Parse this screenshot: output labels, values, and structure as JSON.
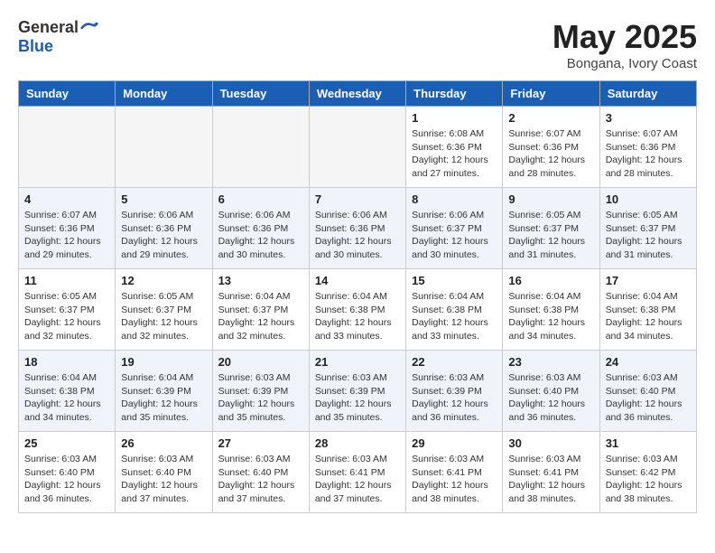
{
  "logo": {
    "general": "General",
    "blue": "Blue"
  },
  "title": "May 2025",
  "location": "Bongana, Ivory Coast",
  "days_of_week": [
    "Sunday",
    "Monday",
    "Tuesday",
    "Wednesday",
    "Thursday",
    "Friday",
    "Saturday"
  ],
  "weeks": [
    [
      {
        "num": "",
        "info": ""
      },
      {
        "num": "",
        "info": ""
      },
      {
        "num": "",
        "info": ""
      },
      {
        "num": "",
        "info": ""
      },
      {
        "num": "1",
        "info": "Sunrise: 6:08 AM\nSunset: 6:36 PM\nDaylight: 12 hours\nand 27 minutes."
      },
      {
        "num": "2",
        "info": "Sunrise: 6:07 AM\nSunset: 6:36 PM\nDaylight: 12 hours\nand 28 minutes."
      },
      {
        "num": "3",
        "info": "Sunrise: 6:07 AM\nSunset: 6:36 PM\nDaylight: 12 hours\nand 28 minutes."
      }
    ],
    [
      {
        "num": "4",
        "info": "Sunrise: 6:07 AM\nSunset: 6:36 PM\nDaylight: 12 hours\nand 29 minutes."
      },
      {
        "num": "5",
        "info": "Sunrise: 6:06 AM\nSunset: 6:36 PM\nDaylight: 12 hours\nand 29 minutes."
      },
      {
        "num": "6",
        "info": "Sunrise: 6:06 AM\nSunset: 6:36 PM\nDaylight: 12 hours\nand 30 minutes."
      },
      {
        "num": "7",
        "info": "Sunrise: 6:06 AM\nSunset: 6:36 PM\nDaylight: 12 hours\nand 30 minutes."
      },
      {
        "num": "8",
        "info": "Sunrise: 6:06 AM\nSunset: 6:37 PM\nDaylight: 12 hours\nand 30 minutes."
      },
      {
        "num": "9",
        "info": "Sunrise: 6:05 AM\nSunset: 6:37 PM\nDaylight: 12 hours\nand 31 minutes."
      },
      {
        "num": "10",
        "info": "Sunrise: 6:05 AM\nSunset: 6:37 PM\nDaylight: 12 hours\nand 31 minutes."
      }
    ],
    [
      {
        "num": "11",
        "info": "Sunrise: 6:05 AM\nSunset: 6:37 PM\nDaylight: 12 hours\nand 32 minutes."
      },
      {
        "num": "12",
        "info": "Sunrise: 6:05 AM\nSunset: 6:37 PM\nDaylight: 12 hours\nand 32 minutes."
      },
      {
        "num": "13",
        "info": "Sunrise: 6:04 AM\nSunset: 6:37 PM\nDaylight: 12 hours\nand 32 minutes."
      },
      {
        "num": "14",
        "info": "Sunrise: 6:04 AM\nSunset: 6:38 PM\nDaylight: 12 hours\nand 33 minutes."
      },
      {
        "num": "15",
        "info": "Sunrise: 6:04 AM\nSunset: 6:38 PM\nDaylight: 12 hours\nand 33 minutes."
      },
      {
        "num": "16",
        "info": "Sunrise: 6:04 AM\nSunset: 6:38 PM\nDaylight: 12 hours\nand 34 minutes."
      },
      {
        "num": "17",
        "info": "Sunrise: 6:04 AM\nSunset: 6:38 PM\nDaylight: 12 hours\nand 34 minutes."
      }
    ],
    [
      {
        "num": "18",
        "info": "Sunrise: 6:04 AM\nSunset: 6:38 PM\nDaylight: 12 hours\nand 34 minutes."
      },
      {
        "num": "19",
        "info": "Sunrise: 6:04 AM\nSunset: 6:39 PM\nDaylight: 12 hours\nand 35 minutes."
      },
      {
        "num": "20",
        "info": "Sunrise: 6:03 AM\nSunset: 6:39 PM\nDaylight: 12 hours\nand 35 minutes."
      },
      {
        "num": "21",
        "info": "Sunrise: 6:03 AM\nSunset: 6:39 PM\nDaylight: 12 hours\nand 35 minutes."
      },
      {
        "num": "22",
        "info": "Sunrise: 6:03 AM\nSunset: 6:39 PM\nDaylight: 12 hours\nand 36 minutes."
      },
      {
        "num": "23",
        "info": "Sunrise: 6:03 AM\nSunset: 6:40 PM\nDaylight: 12 hours\nand 36 minutes."
      },
      {
        "num": "24",
        "info": "Sunrise: 6:03 AM\nSunset: 6:40 PM\nDaylight: 12 hours\nand 36 minutes."
      }
    ],
    [
      {
        "num": "25",
        "info": "Sunrise: 6:03 AM\nSunset: 6:40 PM\nDaylight: 12 hours\nand 36 minutes."
      },
      {
        "num": "26",
        "info": "Sunrise: 6:03 AM\nSunset: 6:40 PM\nDaylight: 12 hours\nand 37 minutes."
      },
      {
        "num": "27",
        "info": "Sunrise: 6:03 AM\nSunset: 6:40 PM\nDaylight: 12 hours\nand 37 minutes."
      },
      {
        "num": "28",
        "info": "Sunrise: 6:03 AM\nSunset: 6:41 PM\nDaylight: 12 hours\nand 37 minutes."
      },
      {
        "num": "29",
        "info": "Sunrise: 6:03 AM\nSunset: 6:41 PM\nDaylight: 12 hours\nand 38 minutes."
      },
      {
        "num": "30",
        "info": "Sunrise: 6:03 AM\nSunset: 6:41 PM\nDaylight: 12 hours\nand 38 minutes."
      },
      {
        "num": "31",
        "info": "Sunrise: 6:03 AM\nSunset: 6:42 PM\nDaylight: 12 hours\nand 38 minutes."
      }
    ]
  ]
}
